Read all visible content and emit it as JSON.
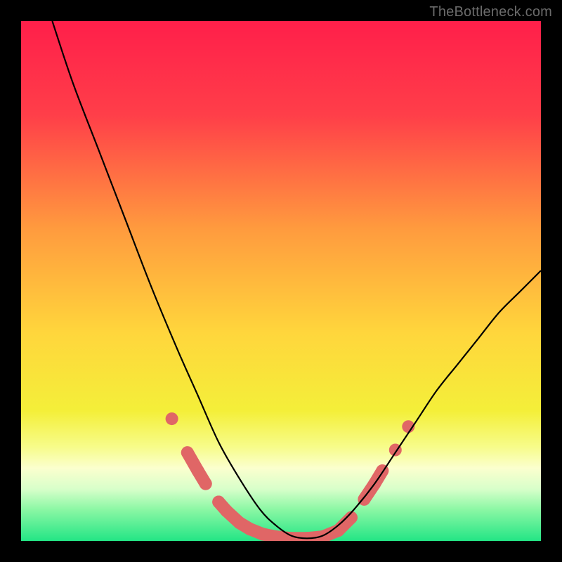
{
  "watermark": {
    "text": "TheBottleneck.com"
  },
  "chart_data": {
    "type": "line",
    "title": "",
    "xlabel": "",
    "ylabel": "",
    "xlim": [
      0,
      100
    ],
    "ylim": [
      0,
      100
    ],
    "grid": false,
    "legend": false,
    "series": [
      {
        "name": "curve",
        "x": [
          6,
          10,
          15,
          20,
          25,
          30,
          34,
          38,
          42,
          46,
          49,
          52,
          55,
          58,
          61,
          64,
          68,
          72,
          76,
          80,
          84,
          88,
          92,
          96,
          100
        ],
        "y": [
          100,
          88,
          75,
          62,
          49,
          37,
          28,
          19,
          12,
          6,
          3,
          1,
          0.5,
          1,
          3,
          6,
          11,
          17,
          23,
          29,
          34,
          39,
          44,
          48,
          52
        ]
      }
    ],
    "markers": [
      {
        "x": 29,
        "y": 23.5
      },
      {
        "x": 32,
        "y": 17
      },
      {
        "x": 34,
        "y": 13.5
      },
      {
        "x": 35.5,
        "y": 11
      },
      {
        "x": 38,
        "y": 7.5
      },
      {
        "x": 39.5,
        "y": 5.8
      },
      {
        "x": 42,
        "y": 3.5
      },
      {
        "x": 44,
        "y": 2.3
      },
      {
        "x": 46.5,
        "y": 1.3
      },
      {
        "x": 49,
        "y": 0.8
      },
      {
        "x": 52,
        "y": 0.5
      },
      {
        "x": 55,
        "y": 0.5
      },
      {
        "x": 58,
        "y": 0.8
      },
      {
        "x": 61,
        "y": 2
      },
      {
        "x": 63.5,
        "y": 4.5
      },
      {
        "x": 66,
        "y": 8
      },
      {
        "x": 68,
        "y": 11
      },
      {
        "x": 69.5,
        "y": 13.5
      },
      {
        "x": 72,
        "y": 17.5
      },
      {
        "x": 74.5,
        "y": 22
      }
    ],
    "background_gradient": {
      "stops": [
        {
          "offset": 0.0,
          "color": "#ff1f4a"
        },
        {
          "offset": 0.18,
          "color": "#ff3e49"
        },
        {
          "offset": 0.4,
          "color": "#ff9b3e"
        },
        {
          "offset": 0.6,
          "color": "#ffd63c"
        },
        {
          "offset": 0.75,
          "color": "#f4ef39"
        },
        {
          "offset": 0.82,
          "color": "#f7fc8b"
        },
        {
          "offset": 0.86,
          "color": "#fbffce"
        },
        {
          "offset": 0.9,
          "color": "#d8ffca"
        },
        {
          "offset": 0.94,
          "color": "#8af7a4"
        },
        {
          "offset": 1.0,
          "color": "#23e585"
        }
      ]
    },
    "curve_color": "#000000",
    "marker_color": "#e06666",
    "marker_radius": 9
  }
}
